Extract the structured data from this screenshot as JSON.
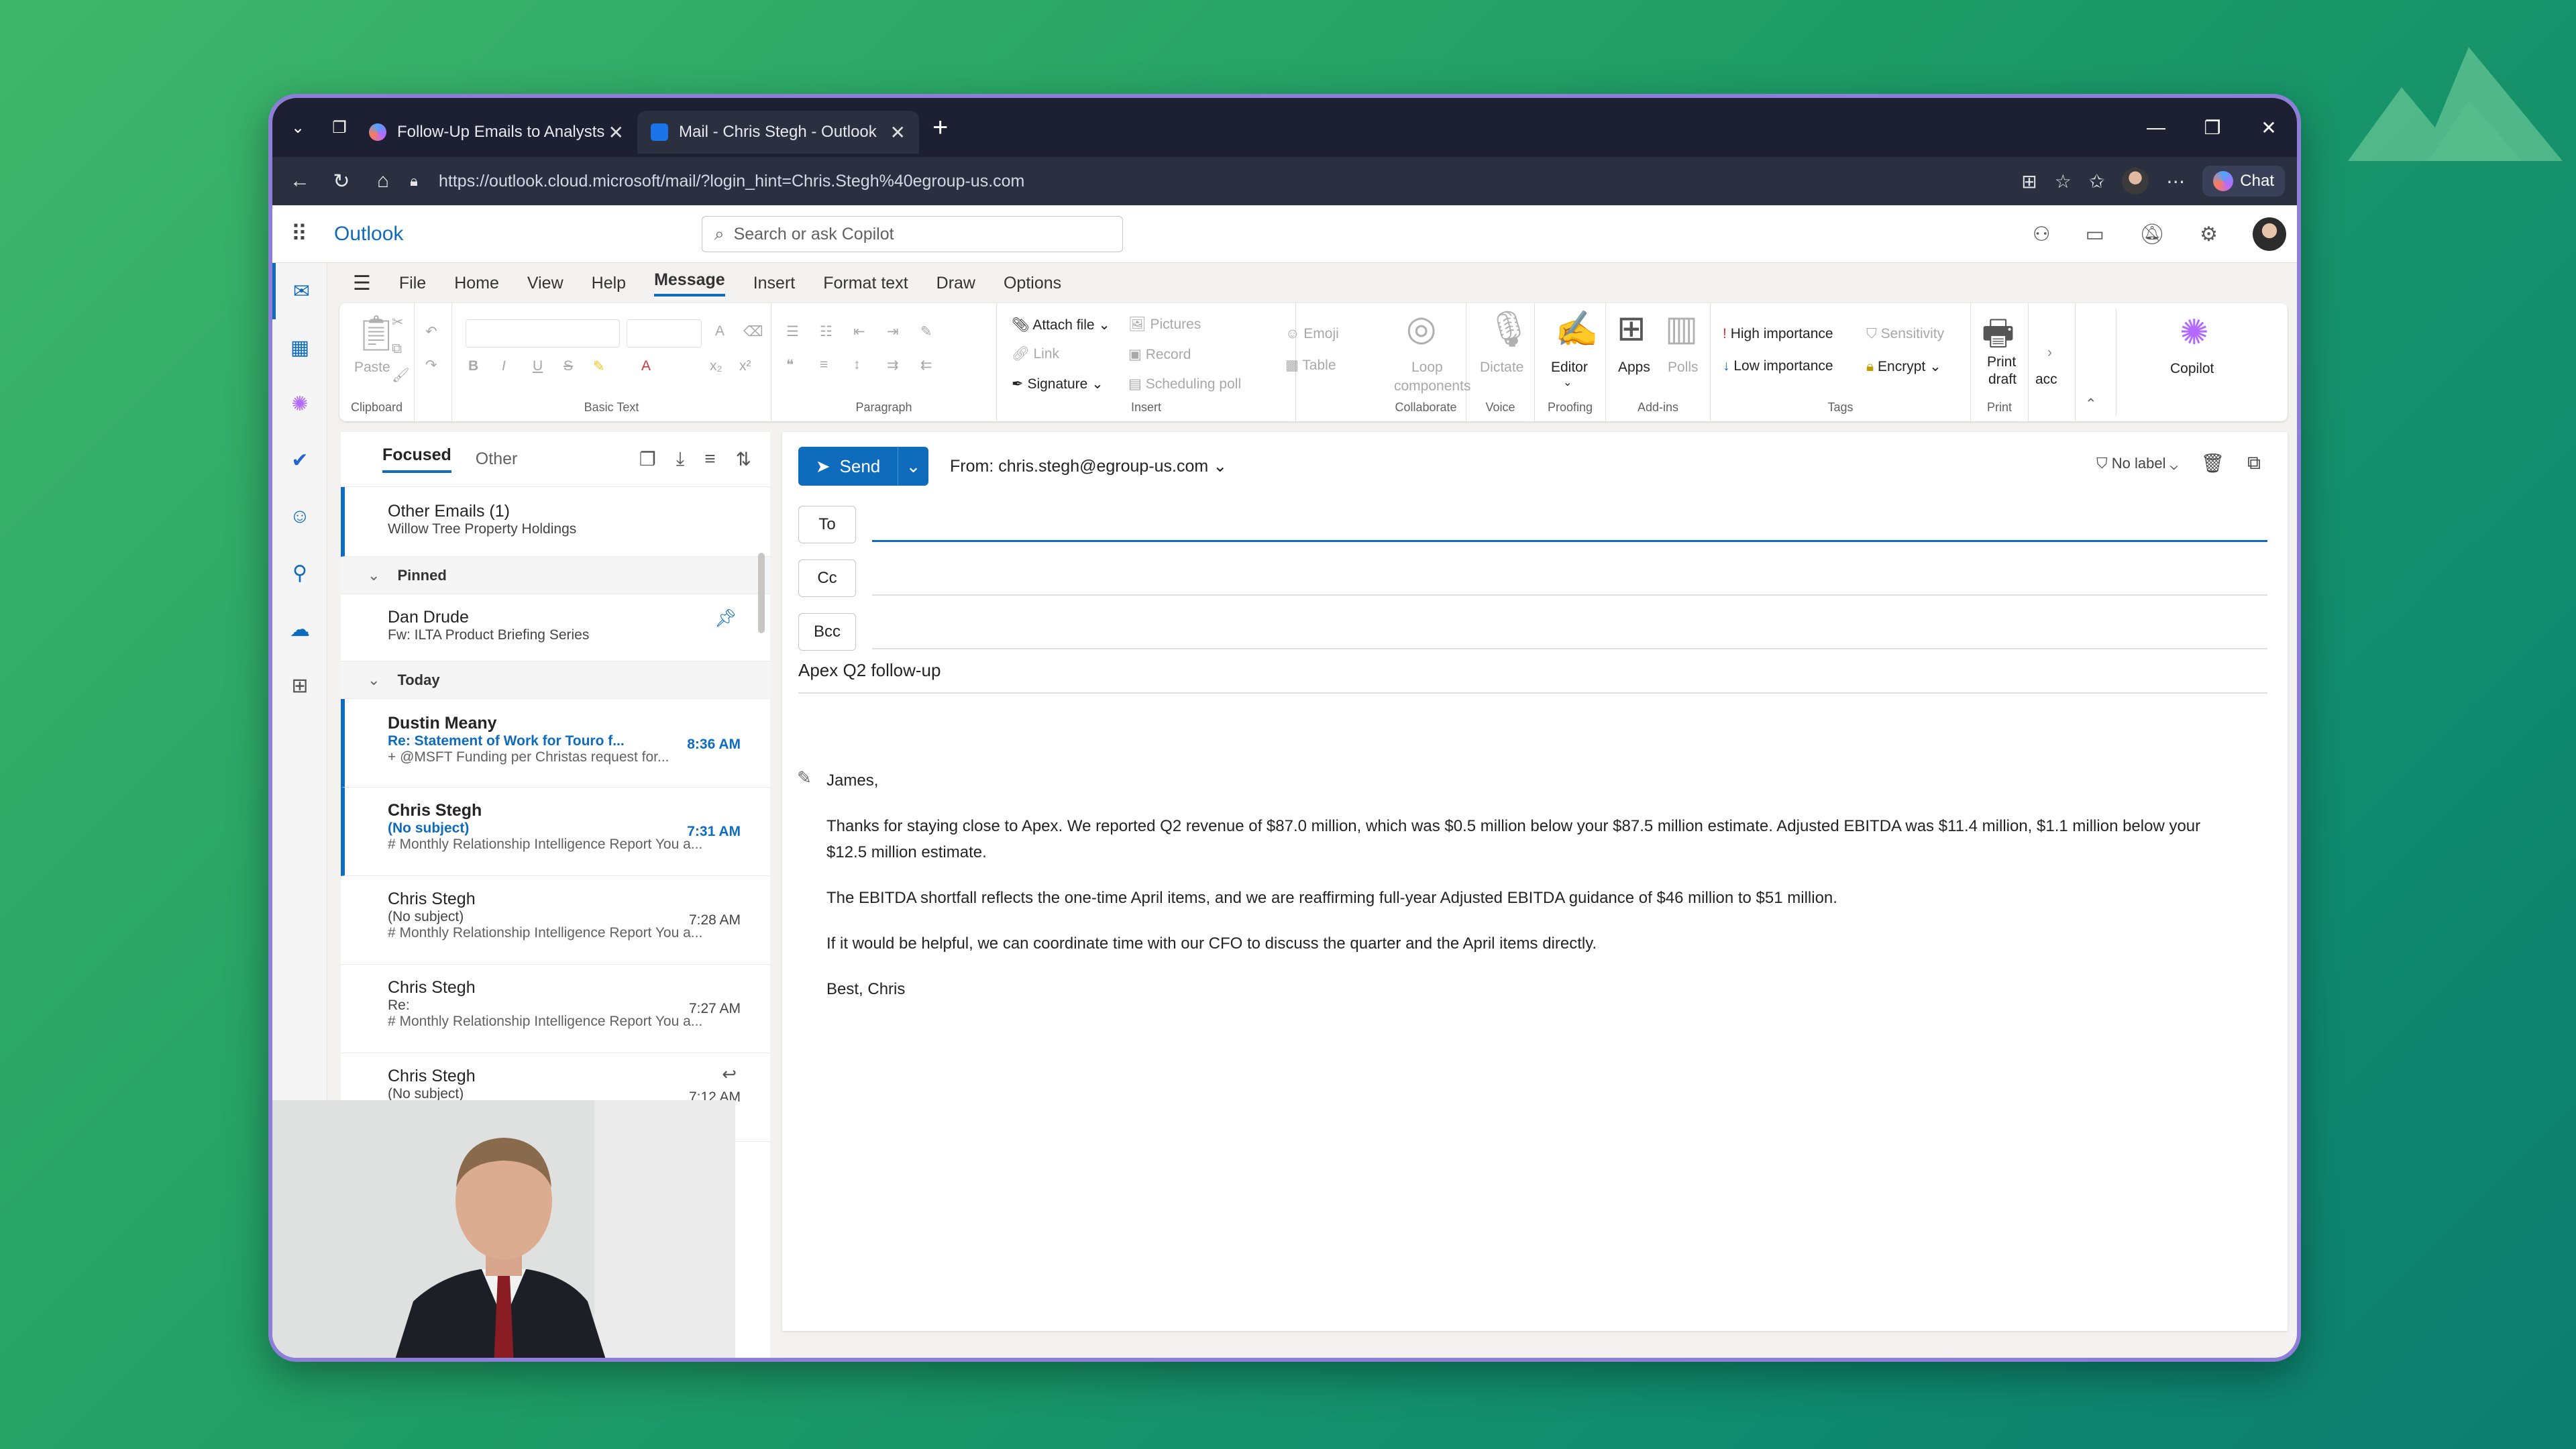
{
  "browser": {
    "tabs": [
      {
        "title": "Follow-Up Emails to Analysts",
        "active": false
      },
      {
        "title": "Mail - Chris Stegh - Outlook",
        "active": true
      }
    ],
    "url": "https://outlook.cloud.microsoft/mail/?login_hint=Chris.Stegh%40egroup-us.com",
    "chat_label": "Chat"
  },
  "app": {
    "name": "Outlook",
    "search_placeholder": "Search or ask Copilot"
  },
  "menu": [
    "File",
    "Home",
    "View",
    "Help",
    "Message",
    "Insert",
    "Format text",
    "Draw",
    "Options"
  ],
  "menu_active": "Message",
  "ribbon": {
    "clipboard": {
      "label": "Clipboard",
      "paste": "Paste"
    },
    "basic_text": {
      "label": "Basic Text"
    },
    "paragraph": {
      "label": "Paragraph"
    },
    "insert": {
      "label": "Insert",
      "attach": "Attach file",
      "link": "Link",
      "signature": "Signature",
      "pictures": "Pictures",
      "record": "Record",
      "scheduling": "Scheduling poll",
      "emoji": "Emoji",
      "table": "Table"
    },
    "collaborate": {
      "label": "Collaborate",
      "loop1": "Loop",
      "loop2": "components"
    },
    "voice": {
      "label": "Voice",
      "dictate": "Dictate"
    },
    "proofing": {
      "label": "Proofing",
      "editor": "Editor"
    },
    "addins": {
      "label": "Add-ins",
      "apps": "Apps",
      "polls": "Polls"
    },
    "tags": {
      "label": "Tags",
      "high": "High importance",
      "low": "Low importance",
      "sensitivity": "Sensitivity",
      "encrypt": "Encrypt"
    },
    "print": {
      "label": "Print",
      "line1": "Print",
      "line2": "draft"
    },
    "acc": "acc",
    "copilot": "Copilot"
  },
  "list": {
    "tab_focused": "Focused",
    "tab_other": "Other",
    "other_emails": {
      "title": "Other Emails (1)",
      "sub": "Willow Tree Property Holdings"
    },
    "pinned_label": "Pinned",
    "today_label": "Today",
    "pinned": [
      {
        "from": "Dan Drude",
        "subject": "Fw: ILTA Product Briefing Series"
      }
    ],
    "today": [
      {
        "from": "Dustin Meany",
        "subject": "Re: Statement of Work for Touro f...",
        "time": "8:36 AM",
        "preview": "+ @MSFT Funding per Christas request for..."
      },
      {
        "from": "Chris Stegh",
        "subject": "(No subject)",
        "time": "7:31 AM",
        "preview": "# Monthly Relationship Intelligence Report You a..."
      },
      {
        "from": "Chris Stegh",
        "subject": "(No subject)",
        "time": "7:28 AM",
        "preview": "# Monthly Relationship Intelligence Report You a..."
      },
      {
        "from": "Chris Stegh",
        "subject": "Re:",
        "time": "7:27 AM",
        "preview": "# Monthly Relationship Intelligence Report You a..."
      },
      {
        "from": "Chris Stegh",
        "subject": "(No subject)",
        "time": "7:12 AM",
        "preview": ""
      }
    ]
  },
  "compose": {
    "send": "Send",
    "from": "From: chris.stegh@egroup-us.com",
    "no_label": "No label",
    "to_label": "To",
    "cc_label": "Cc",
    "bcc_label": "Bcc",
    "subject": "Apex Q2 follow-up",
    "greeting": "James,",
    "para1": "Thanks for staying close to Apex. We reported Q2 revenue of $87.0 million, which was $0.5 million below your $87.5 million estimate. Adjusted EBITDA was $11.4 million, $1.1 million below your $12.5 million estimate.",
    "para2": "The EBITDA shortfall reflects the one-time April items, and we are reaffirming full-year Adjusted EBITDA guidance of $46 million to $51 million.",
    "para3": "If it would be helpful, we can coordinate time with our CFO to discuss the quarter and the April items directly.",
    "signoff": "Best, Chris"
  },
  "colors": {
    "accent": "#0f6cbd",
    "chrome": "#1d1f32",
    "frame": "#8d7fd8"
  }
}
